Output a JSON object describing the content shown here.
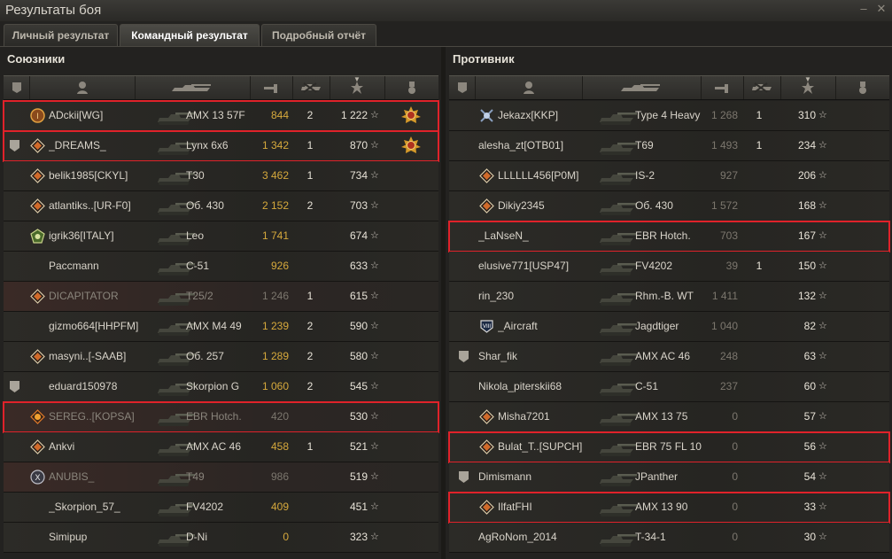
{
  "window": {
    "title": "Результаты боя"
  },
  "tabs": [
    {
      "label": "Личный результат",
      "active": false
    },
    {
      "label": "Командный результат",
      "active": true
    },
    {
      "label": "Подробный отчёт",
      "active": false
    }
  ],
  "colors": {
    "highlight": "#e0222a",
    "damage": "#d6a93c"
  },
  "allies": {
    "title": "Союзники",
    "rows": [
      {
        "badge": "bronze-rank-badge",
        "name": "ADckii[WG]",
        "tank": "AMX 13 57F",
        "damage": "844",
        "kills": "2",
        "xp": "1 222",
        "medal": "order-medal",
        "highlighted": true,
        "dead": false,
        "damage_style": "gold"
      },
      {
        "squad": "1",
        "badge": "diamond-badge",
        "name": "_DREAMS_",
        "tank": "Lynx 6x6",
        "damage": "1 342",
        "kills": "1",
        "xp": "870",
        "medal": "order-medal",
        "highlighted": true,
        "dead": false,
        "damage_style": "gold"
      },
      {
        "badge": "diamond-badge",
        "name": "belik1985[CKYL]",
        "tank": "T30",
        "damage": "3 462",
        "kills": "1",
        "xp": "734",
        "highlighted": false,
        "dead": false,
        "damage_style": "gold"
      },
      {
        "badge": "diamond-badge",
        "name": "atlantiks..[UR-F0]",
        "tank": "Об. 430",
        "damage": "2 152",
        "kills": "2",
        "xp": "703",
        "highlighted": false,
        "dead": false,
        "damage_style": "gold"
      },
      {
        "badge": "green-rank-badge",
        "name": "igrik36[ITALY]",
        "tank": "Leo",
        "damage": "1 741",
        "kills": "",
        "xp": "674",
        "highlighted": false,
        "dead": false,
        "damage_style": "gold"
      },
      {
        "name": "Paccmann",
        "tank": "C-51",
        "damage": "926",
        "kills": "",
        "xp": "633",
        "highlighted": false,
        "dead": false,
        "damage_style": "gold"
      },
      {
        "badge": "diamond-badge",
        "name": "DICAPITATOR",
        "tank": "T25/2",
        "damage": "1 246",
        "kills": "1",
        "xp": "615",
        "highlighted": false,
        "dead": true,
        "damage_style": "dim"
      },
      {
        "name": "gizmo664[HHPFM]",
        "tank": "AMX M4 49",
        "damage": "1 239",
        "kills": "2",
        "xp": "590",
        "highlighted": false,
        "dead": false,
        "damage_style": "gold"
      },
      {
        "badge": "diamond-badge",
        "name": "masyni..[-SAAB]",
        "tank": "Об. 257",
        "damage": "1 289",
        "kills": "2",
        "xp": "580",
        "highlighted": false,
        "dead": false,
        "damage_style": "gold"
      },
      {
        "squad": "1",
        "name": "eduard150978",
        "tank": "Skorpion G",
        "damage": "1 060",
        "kills": "2",
        "xp": "545",
        "highlighted": false,
        "dead": false,
        "damage_style": "gold"
      },
      {
        "badge": "flame-rank-badge",
        "name": "SEREG..[KOPSA]",
        "tank": "EBR Hotch.",
        "damage": "420",
        "kills": "",
        "xp": "530",
        "highlighted": true,
        "dead": true,
        "damage_style": "dim"
      },
      {
        "badge": "diamond-badge",
        "name": "Ankvi",
        "tank": "AMX AC 46",
        "damage": "458",
        "kills": "1",
        "xp": "521",
        "highlighted": false,
        "dead": false,
        "damage_style": "gold"
      },
      {
        "badge": "x-rank-badge",
        "name": "ANUBIS_",
        "tank": "T49",
        "damage": "986",
        "kills": "",
        "xp": "519",
        "highlighted": false,
        "dead": true,
        "damage_style": "dim"
      },
      {
        "name": "_Skorpion_57_",
        "tank": "FV4202",
        "damage": "409",
        "kills": "",
        "xp": "451",
        "highlighted": false,
        "dead": false,
        "damage_style": "gold"
      },
      {
        "name": "Simipup",
        "tank": "D-Ni",
        "damage": "0",
        "kills": "",
        "xp": "323",
        "highlighted": false,
        "dead": false,
        "damage_style": "gold"
      }
    ]
  },
  "enemies": {
    "title": "Противник",
    "rows": [
      {
        "badge": "crossed-rank-badge",
        "name": "Jekazx[KKP]",
        "tank": "Type 4 Heavy",
        "damage": "1 268",
        "kills": "1",
        "xp": "310",
        "highlighted": false,
        "dead": false,
        "damage_style": "dim"
      },
      {
        "name": "alesha_zt[OTB01]",
        "tank": "T69",
        "damage": "1 493",
        "kills": "1",
        "xp": "234",
        "highlighted": false,
        "dead": false,
        "damage_style": "dim"
      },
      {
        "badge": "diamond-badge",
        "name": "LLLLLL456[P0M]",
        "tank": "IS-2",
        "damage": "927",
        "kills": "",
        "xp": "206",
        "highlighted": false,
        "dead": false,
        "damage_style": "dim"
      },
      {
        "badge": "diamond-badge",
        "name": "Dikiy2345",
        "tank": "Об. 430",
        "damage": "1 572",
        "kills": "",
        "xp": "168",
        "highlighted": false,
        "dead": false,
        "damage_style": "dim"
      },
      {
        "name": "_LaNseN_",
        "tank": "EBR Hotch.",
        "damage": "703",
        "kills": "",
        "xp": "167",
        "highlighted": true,
        "dead": false,
        "damage_style": "dim"
      },
      {
        "name": "elusive771[USP47]",
        "tank": "FV4202",
        "damage": "39",
        "kills": "1",
        "xp": "150",
        "highlighted": false,
        "dead": false,
        "damage_style": "dim"
      },
      {
        "name": "rin_230",
        "tank": "Rhm.-B. WT",
        "damage": "1 411",
        "kills": "",
        "xp": "132",
        "highlighted": false,
        "dead": false,
        "damage_style": "dim"
      },
      {
        "badge": "viii-rank-badge",
        "name": "_Aircraft",
        "tank": "Jagdtiger",
        "damage": "1 040",
        "kills": "",
        "xp": "82",
        "highlighted": false,
        "dead": false,
        "damage_style": "dim"
      },
      {
        "squad": "1",
        "name": "Shar_fik",
        "tank": "AMX AC 46",
        "damage": "248",
        "kills": "",
        "xp": "63",
        "highlighted": false,
        "dead": false,
        "damage_style": "dim"
      },
      {
        "name": "Nikola_piterskii68",
        "tank": "C-51",
        "damage": "237",
        "kills": "",
        "xp": "60",
        "highlighted": false,
        "dead": false,
        "damage_style": "dim"
      },
      {
        "badge": "diamond-badge",
        "name": "Misha7201",
        "tank": "AMX 13 75",
        "damage": "0",
        "kills": "",
        "xp": "57",
        "highlighted": false,
        "dead": false,
        "damage_style": "dim"
      },
      {
        "badge": "diamond-badge",
        "name": "Bulat_T..[SUPCH]",
        "tank": "EBR 75 FL 10",
        "damage": "0",
        "kills": "",
        "xp": "56",
        "highlighted": true,
        "dead": false,
        "damage_style": "dim"
      },
      {
        "squad": "1",
        "name": "Dimismann",
        "tank": "JPanther",
        "damage": "0",
        "kills": "",
        "xp": "54",
        "highlighted": false,
        "dead": false,
        "damage_style": "dim"
      },
      {
        "badge": "diamond-badge",
        "name": "IlfatFHI",
        "tank": "AMX 13 90",
        "damage": "0",
        "kills": "",
        "xp": "33",
        "highlighted": true,
        "dead": false,
        "damage_style": "dim"
      },
      {
        "name": "AgRoNom_2014",
        "tank": "T-34-1",
        "damage": "0",
        "kills": "",
        "xp": "30",
        "highlighted": false,
        "dead": false,
        "damage_style": "dim"
      }
    ]
  },
  "headers": [
    {
      "icon": "squad-icon"
    },
    {
      "icon": "player-icon"
    },
    {
      "icon": "tank-icon"
    },
    {
      "icon": "damage-icon"
    },
    {
      "icon": "kills-icon"
    },
    {
      "icon": "xp-star-icon",
      "sorted": true
    },
    {
      "icon": "medal-icon"
    }
  ]
}
